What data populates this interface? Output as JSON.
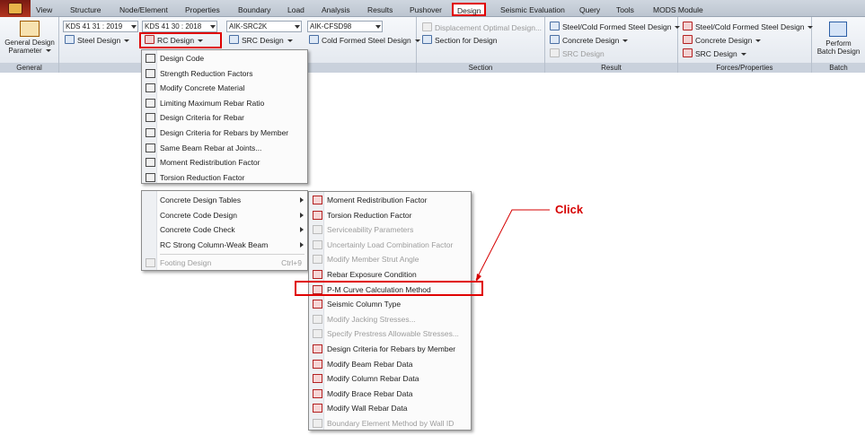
{
  "menubar": {
    "tabs": [
      "View",
      "Structure",
      "Node/Element",
      "Properties",
      "Boundary",
      "Load",
      "Analysis",
      "Results",
      "Pushover",
      "Design",
      "Seismic Evaluation",
      "Query",
      "Tools",
      "MODS Module"
    ],
    "active_tab": "Design"
  },
  "ribbon": {
    "general": {
      "button": "General Design",
      "button2": "Parameter",
      "label": "General"
    },
    "combos": {
      "steel_code": "KDS 41 31 : 2019",
      "rc_code": "KDS 41 30 : 2018",
      "src_code": "AIK-SRC2K",
      "cfs_code": "AIK-CFSD98"
    },
    "buttons": {
      "steel_design": "Steel Design",
      "rc_design": "RC Design",
      "src_design": "SRC Design",
      "cold_formed": "Cold Formed Steel Design"
    },
    "section": {
      "displacement": "Displacement Optimal Design...",
      "section_for_design": "Section for Design",
      "label": "Section"
    },
    "result": {
      "steel": "Steel/Cold Formed Steel Design",
      "concrete": "Concrete Design",
      "src": "SRC Design",
      "label": "Result"
    },
    "forces": {
      "steel": "Steel/Cold Formed Steel Design",
      "concrete": "Concrete Design",
      "src": "SRC Design",
      "label": "Forces/Properties"
    },
    "batch": {
      "button": "Perform",
      "button2": "Batch Design",
      "label": "Batch"
    }
  },
  "rc_menu": {
    "items": [
      "Design Code",
      "Strength Reduction Factors",
      "Modify Concrete Material",
      "Limiting Maximum Rebar Ratio",
      "Design Criteria for Rebar",
      "Design Criteria for Rebars by Member",
      "Same Beam Rebar at Joints...",
      "Moment Redistribution Factor",
      "Torsion Reduction Factor"
    ]
  },
  "rc_menu2": {
    "items": [
      "Concrete Design Tables",
      "Concrete Code Design",
      "Concrete Code Check",
      "RC Strong Column-Weak Beam"
    ],
    "footing": "Footing Design",
    "footing_shortcut": "Ctrl+9"
  },
  "tables_menu": {
    "items": [
      "Moment Redistribution Factor",
      "Torsion Reduction Factor",
      "Serviceability Parameters",
      "Uncertainly Load Combination Factor",
      "Modify Member Strut Angle",
      "Rebar Exposure Condition",
      "P-M Curve Calculation Method",
      "Seismic Column Type",
      "Modify Jacking Stresses...",
      "Specify Prestress Allowable Stresses...",
      "Design Criteria for Rebars by Member",
      "Modify Beam Rebar Data",
      "Modify Column Rebar Data",
      "Modify Brace Rebar Data",
      "Modify Wall Rebar Data",
      "Boundary Element Method by Wall ID"
    ]
  },
  "annotation": {
    "click": "Click"
  },
  "colors": {
    "highlight": "#e00000",
    "ribbon_bg": "#e8ecf2"
  }
}
